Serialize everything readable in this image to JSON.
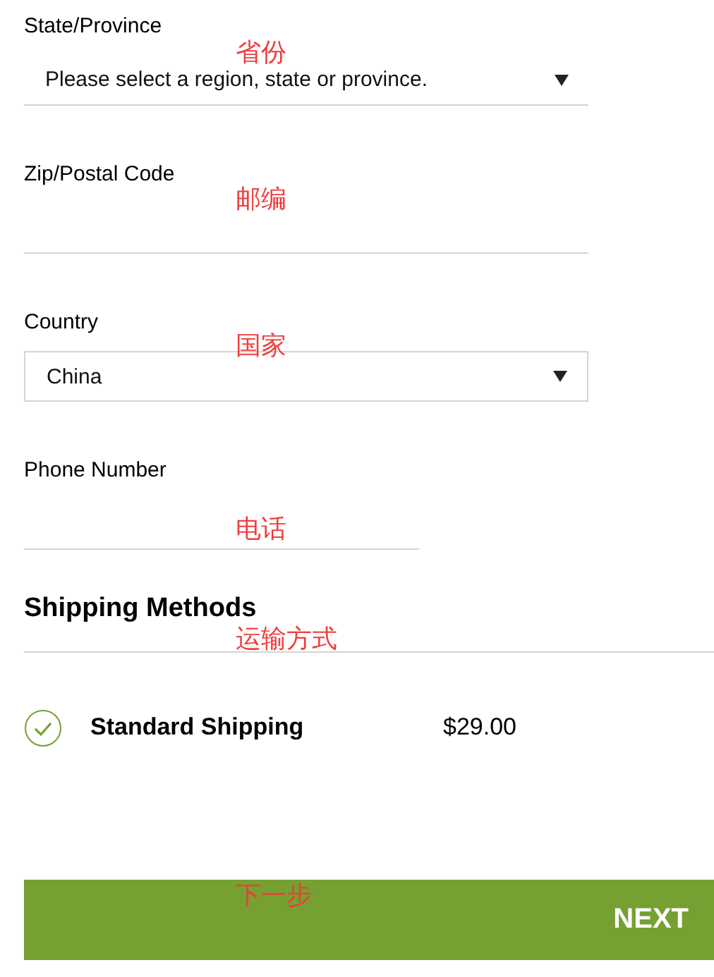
{
  "fields": [
    {
      "kind": "select",
      "label": "State/Province",
      "value": "Please select a region, state or province.",
      "annotation": "省份",
      "boxed": false
    },
    {
      "kind": "text",
      "label": "Zip/Postal Code",
      "annotation": "邮编",
      "short": false
    },
    {
      "kind": "select",
      "label": "Country",
      "value": "China",
      "annotation": "国家",
      "boxed": true
    },
    {
      "kind": "text",
      "label": "Phone Number",
      "annotation": "电话",
      "short": true
    }
  ],
  "shipping": {
    "title": "Shipping Methods",
    "annotation": "运输方式",
    "methods": [
      {
        "name": "Standard Shipping",
        "price": "$29.00",
        "selected": true
      }
    ]
  },
  "next_button": {
    "label": "NEXT",
    "annotation": "下一步"
  }
}
